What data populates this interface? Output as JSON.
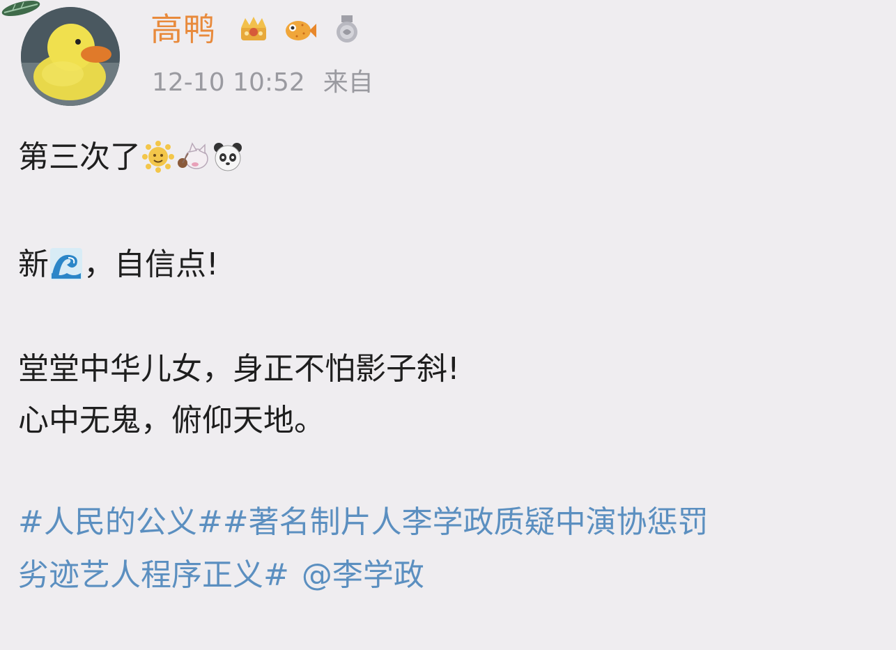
{
  "post": {
    "username": "高鸭",
    "timestamp": "12-10 10:52",
    "source_label": "来自",
    "line1": "第三次了",
    "line2_prefix": "新",
    "line2_suffix": "，自信点!",
    "line3": "堂堂中华儿女，身正不怕影子斜!",
    "line4": "心中无鬼，俯仰天地。",
    "hashtags_line1": "#人民的公义##著名制片人李学政质疑中演协惩罚",
    "hashtags_line2": "劣迹艺人程序正义#",
    "mention": "@李学政"
  },
  "icons": {
    "badges": [
      "crown-badge-icon",
      "pufferfish-badge-icon",
      "medal-badge-icon"
    ],
    "emojis_line1": [
      "sun-face-emoji-icon",
      "cat-lollipop-emoji-icon",
      "panda-face-emoji-icon"
    ],
    "emoji_line2": "wave-emoji-icon"
  },
  "colors": {
    "username": "#e88a3c",
    "link": "#5b8fc0",
    "meta": "#9a9aa0",
    "text": "#1e1e1e",
    "background": "#efedf0"
  }
}
